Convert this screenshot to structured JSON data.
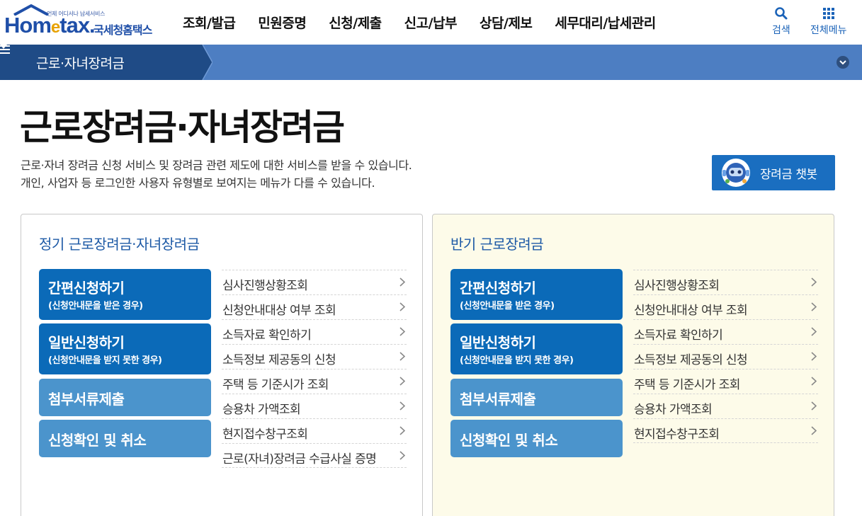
{
  "header": {
    "logo_small": "언제 어디서나 납세서비스",
    "logo_brand_a": "Hom",
    "logo_brand_e": "e",
    "logo_brand_b": "tax.",
    "logo_korean": "국세청홈택스",
    "gnb": [
      "조회/발급",
      "민원증명",
      "신청/제출",
      "신고/납부",
      "상담/제보",
      "세무대리/납세관리"
    ],
    "search_label": "검색",
    "allmenu_label": "전체메뉴"
  },
  "subbar": {
    "crumb_label": "근로·자녀장려금"
  },
  "page": {
    "title": "근로장려금·자녀장려금",
    "desc_line1": "근로·자녀 장려금 신청 서비스 및 장려금 관련 제도에 대한 서비스를 받을 수 있습니다.",
    "desc_line2": "개인, 사업자 등 로그인한 사용자 유형별로 보여지는 메뉴가 다를 수 있습니다.",
    "chatbot_label": "장려금 챗봇"
  },
  "panels": [
    {
      "title": "정기 근로장려금·자녀장려금",
      "buttons": [
        {
          "main": "간편신청하기",
          "sub": "(신청안내문을 받은 경우)"
        },
        {
          "main": "일반신청하기",
          "sub": "(신청안내문을 받지 못한 경우)"
        },
        {
          "main": "첨부서류제출",
          "sub": ""
        },
        {
          "main": "신청확인 및 취소",
          "sub": ""
        }
      ],
      "links": [
        "심사진행상황조회",
        "신청안내대상 여부 조회",
        "소득자료 확인하기",
        "소득정보 제공동의 신청",
        "주택 등 기준시가 조회",
        "승용차 가액조회",
        "현지접수창구조회",
        "근로(자녀)장려금 수급사실 증명"
      ]
    },
    {
      "title": "반기 근로장려금",
      "buttons": [
        {
          "main": "간편신청하기",
          "sub": "(신청안내문을 받은 경우)"
        },
        {
          "main": "일반신청하기",
          "sub": "(신청안내문을 받지 못한 경우)"
        },
        {
          "main": "첨부서류제출",
          "sub": ""
        },
        {
          "main": "신청확인 및 취소",
          "sub": ""
        }
      ],
      "links": [
        "심사진행상황조회",
        "신청안내대상 여부 조회",
        "소득자료 확인하기",
        "소득정보 제공동의 신청",
        "주택 등 기준시가 조회",
        "승용차 가액조회",
        "현지접수창구조회"
      ]
    }
  ],
  "colors": {
    "brand_blue": "#1f4fa8",
    "subbar": "#4d7ec2",
    "button_dark": "#0b6ab8",
    "button_light": "#4b94cc",
    "right_panel_bg": "#fdfbe9"
  },
  "icons": {
    "search": "magnifier-icon",
    "allmenu": "grid-icon",
    "crumb": "hamburger-icon",
    "link_arrow": "chevron-right-icon"
  }
}
